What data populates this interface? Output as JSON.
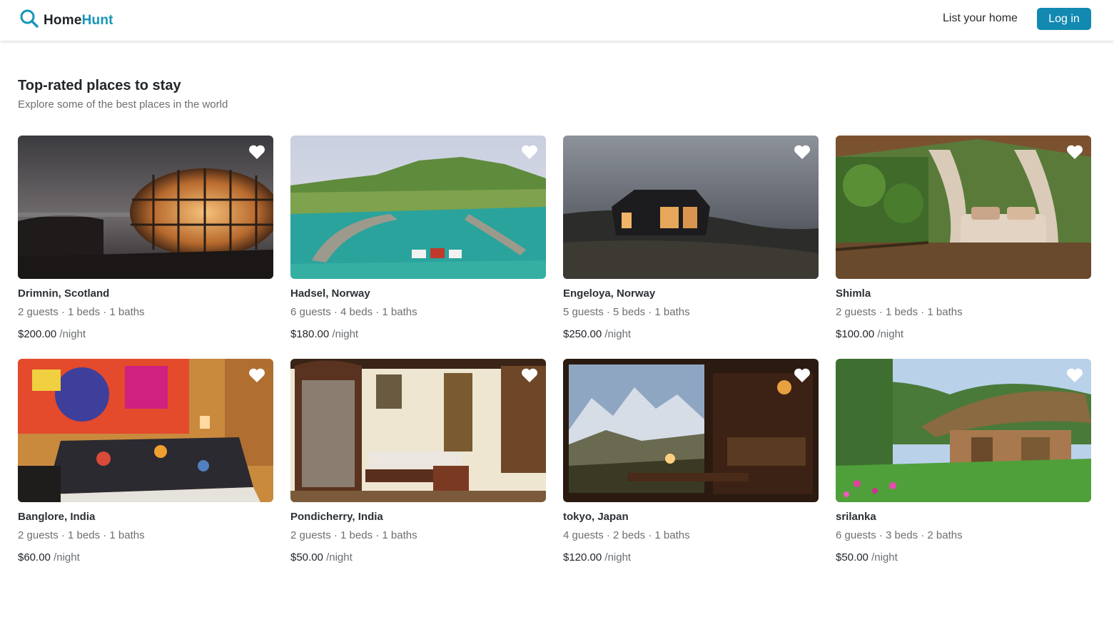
{
  "header": {
    "logo_part1": "Home",
    "logo_part2": "Hunt",
    "list_home_label": "List your home",
    "login_label": "Log in",
    "brand_color": "#1289b1"
  },
  "section": {
    "title": "Top-rated places to stay",
    "subtitle": "Explore some of the best places in the world"
  },
  "listings": [
    {
      "name": "Drimnin, Scotland",
      "details": "2 guests · 1 beds · 1 baths",
      "price": "$200.00",
      "unit": "/night",
      "favorite_icon": "heart-icon"
    },
    {
      "name": "Hadsel, Norway",
      "details": "6 guests · 4 beds · 1 baths",
      "price": "$180.00",
      "unit": "/night",
      "favorite_icon": "heart-icon"
    },
    {
      "name": "Engeloya, Norway",
      "details": "5 guests · 5 beds · 1 baths",
      "price": "$250.00",
      "unit": "/night",
      "favorite_icon": "heart-icon"
    },
    {
      "name": "Shimla",
      "details": "2 guests · 1 beds · 1 baths",
      "price": "$100.00",
      "unit": "/night",
      "favorite_icon": "heart-icon"
    },
    {
      "name": "Banglore, India",
      "details": "2 guests · 1 beds · 1 baths",
      "price": "$60.00",
      "unit": "/night",
      "favorite_icon": "heart-icon"
    },
    {
      "name": "Pondicherry, India",
      "details": "2 guests · 1 beds · 1 baths",
      "price": "$50.00",
      "unit": "/night",
      "favorite_icon": "heart-icon"
    },
    {
      "name": "tokyo, Japan",
      "details": "4 guests · 2 beds · 1 baths",
      "price": "$120.00",
      "unit": "/night",
      "favorite_icon": "heart-icon"
    },
    {
      "name": "srilanka",
      "details": "6 guests · 3 beds · 2 baths",
      "price": "$50.00",
      "unit": "/night",
      "favorite_icon": "heart-icon"
    }
  ]
}
